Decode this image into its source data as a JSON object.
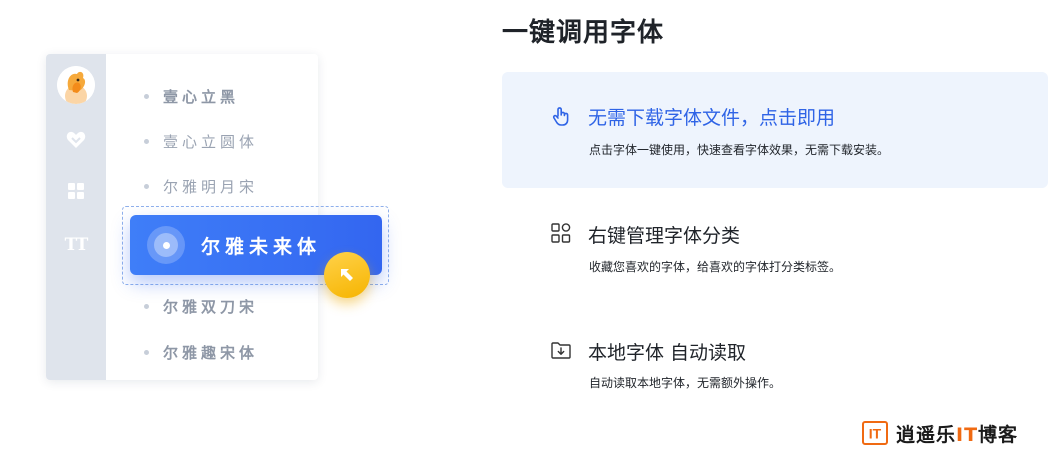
{
  "left_panel": {
    "rail_icons": [
      "avatar-icon",
      "heart-icon",
      "grid-icon",
      "text-size-icon"
    ],
    "rail_tt_label": "TT",
    "font_list": [
      {
        "label": "壹心立黑"
      },
      {
        "label": "壹心立圆体"
      },
      {
        "label": "尔雅明月宋"
      },
      {
        "label": "尔雅双刀宋"
      },
      {
        "label": "尔雅趣宋体"
      }
    ],
    "selected_font": "尔雅未来体",
    "accent_color": "#3366f0",
    "cursor_color": "#f6b400"
  },
  "right_panel": {
    "title": "一键调用字体",
    "features": [
      {
        "icon": "tap-icon",
        "title": "无需下载字体文件，点击即用",
        "description": "点击字体一键使用，快速查看字体效果，无需下载安装。",
        "active": true
      },
      {
        "icon": "category-icon",
        "title": "右键管理字体分类",
        "description": "收藏您喜欢的字体，给喜欢的字体打分类标签。",
        "active": false
      },
      {
        "icon": "folder-download-icon",
        "title": "本地字体 自动读取",
        "description": "自动读取本地字体，无需额外操作。",
        "active": false
      }
    ],
    "active_color": "#2f64e6",
    "active_bg": "#eef4fd"
  },
  "watermark": {
    "logo_text": "IT",
    "prefix": "逍遥乐",
    "highlight": "IT",
    "suffix": "博客"
  }
}
